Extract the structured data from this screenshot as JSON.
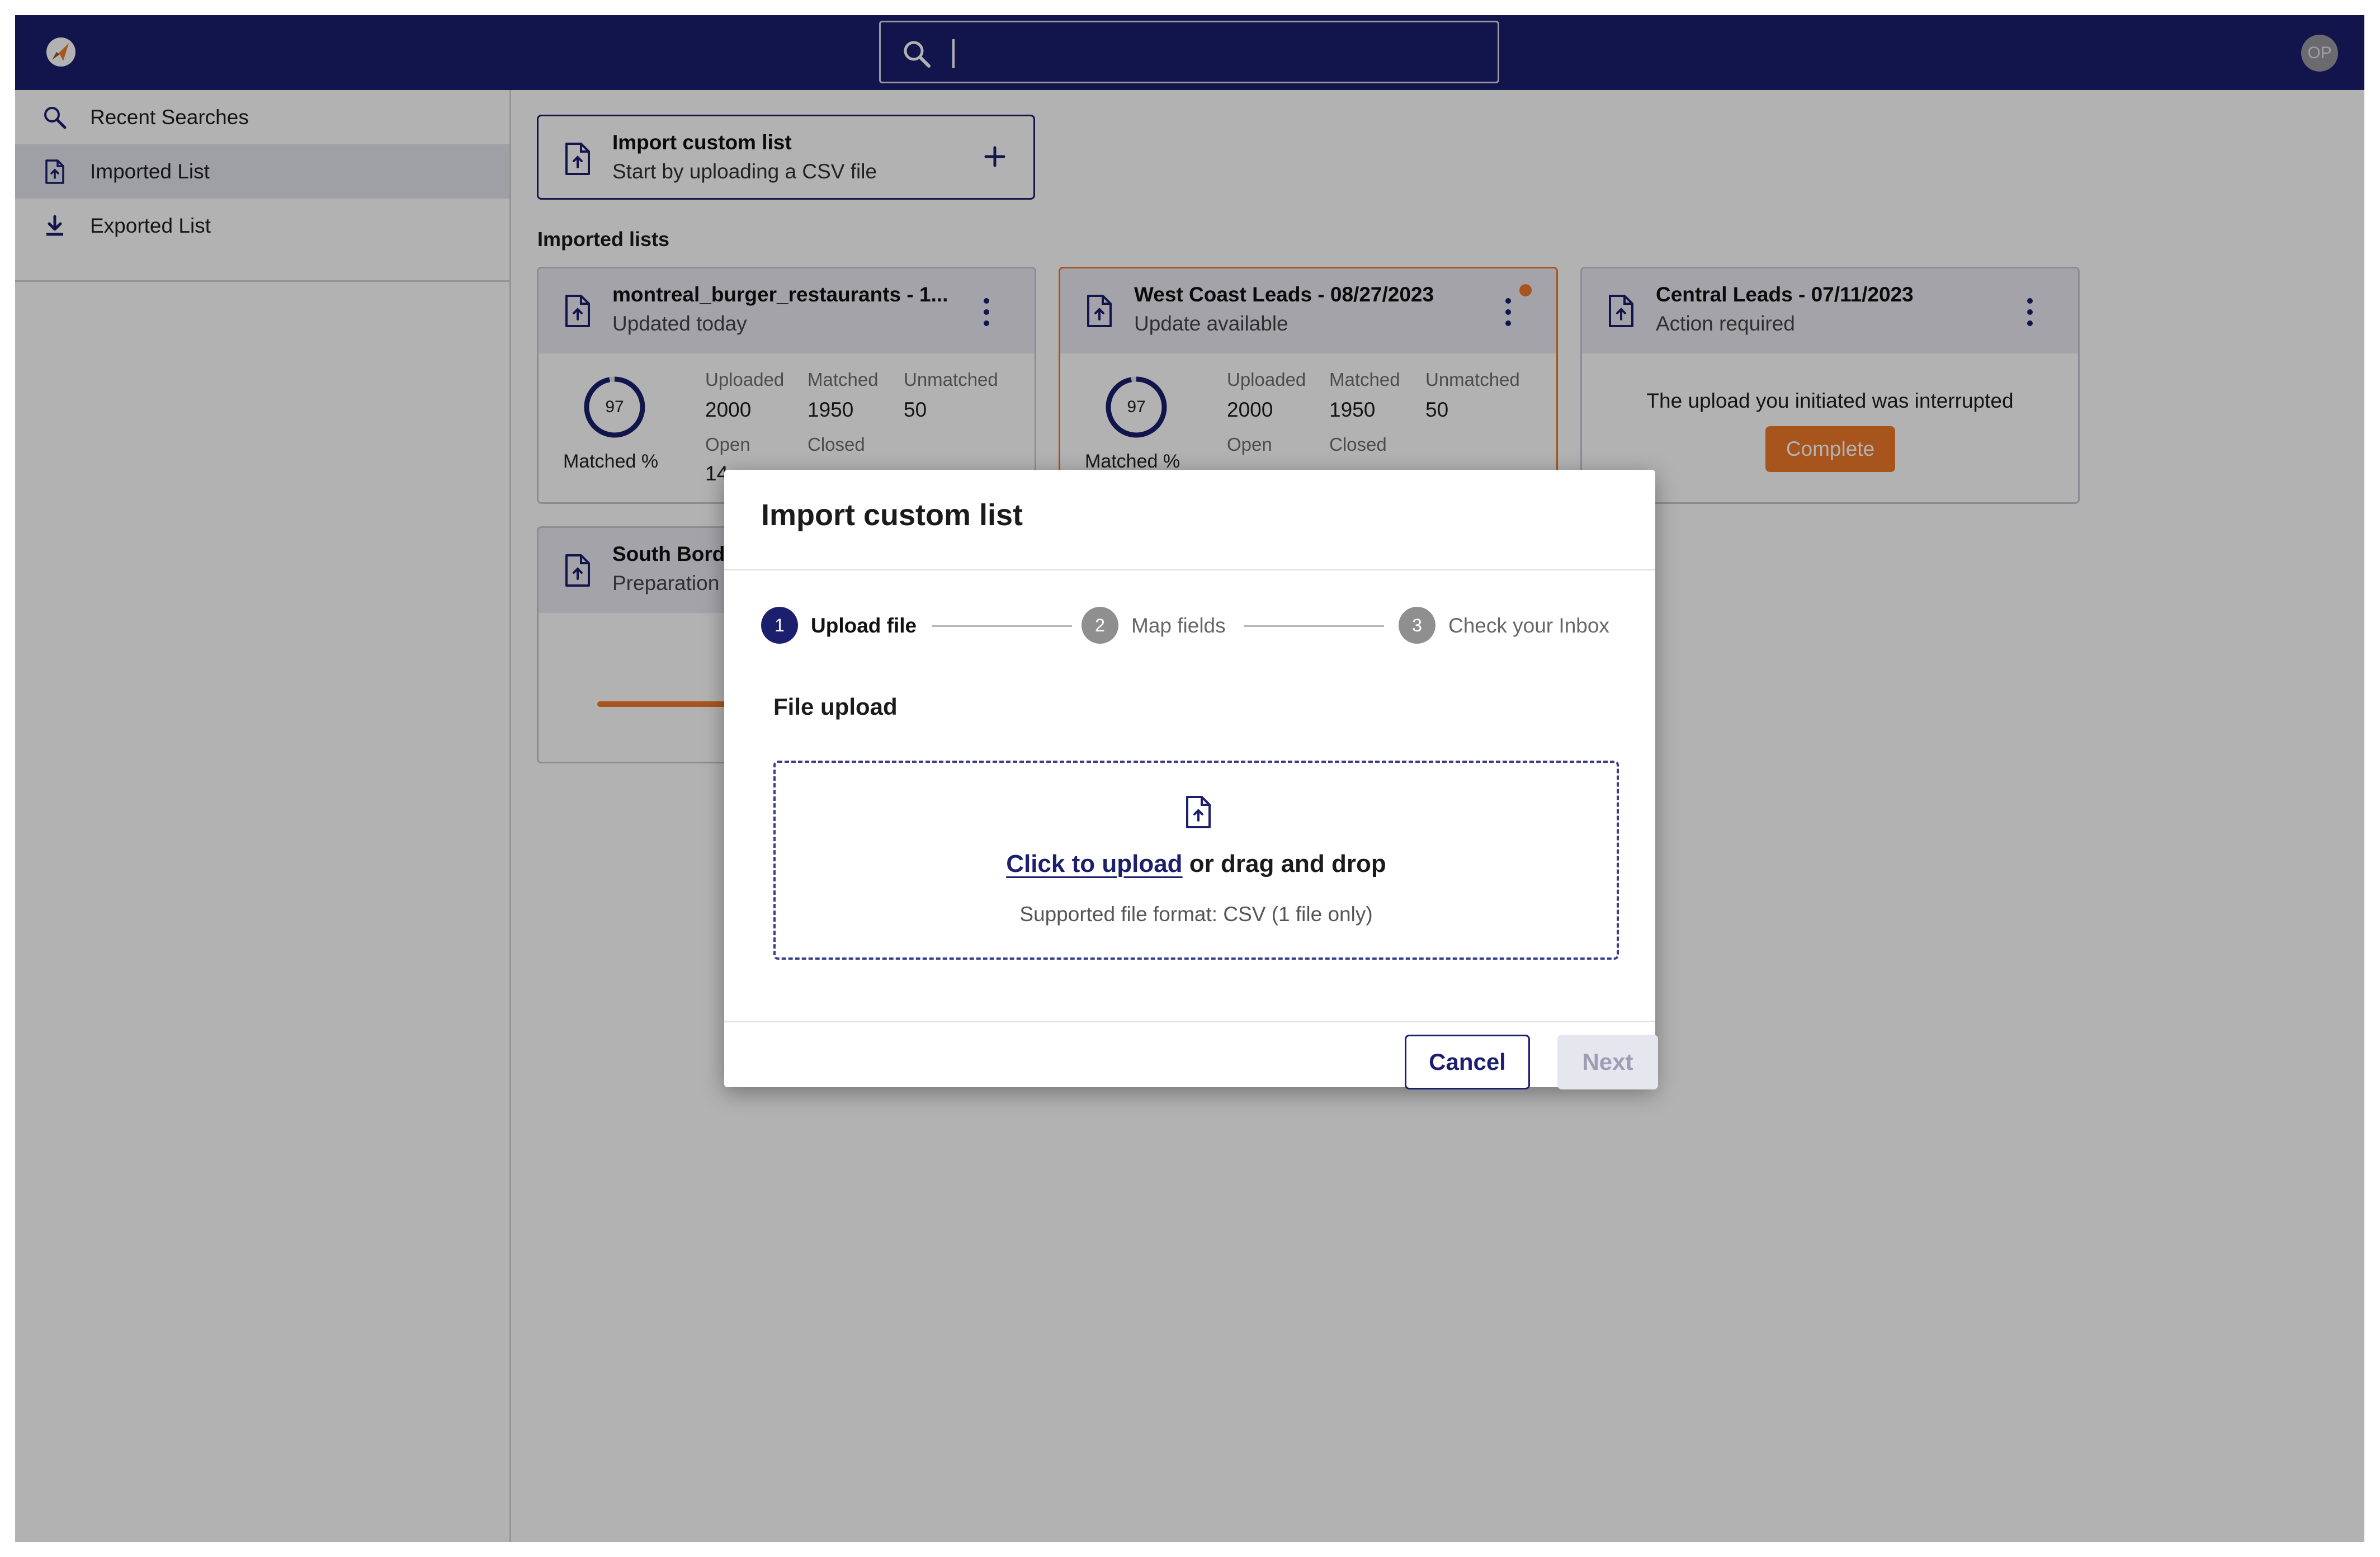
{
  "search": {
    "value": ""
  },
  "user": {
    "initials": "OP"
  },
  "sidebar": {
    "items": [
      {
        "label": "Recent Searches",
        "icon": "search-icon"
      },
      {
        "label": "Imported List",
        "icon": "file-upload-icon"
      },
      {
        "label": "Exported List",
        "icon": "download-icon"
      }
    ]
  },
  "import_button": {
    "title": "Import custom list",
    "subtitle": "Start by uploading a CSV file"
  },
  "section_title": "Imported lists",
  "cards": [
    {
      "title": "montreal_burger_restaurants - 1...",
      "status": "Updated today",
      "matched_pct": "97",
      "matched_pct_fraction": 0.97,
      "matched_label": "Matched %",
      "stats": {
        "uploaded_label": "Uploaded",
        "uploaded": "2000",
        "matched_label": "Matched",
        "matched": "1950",
        "unmatched_label": "Unmatched",
        "unmatched": "50",
        "open_label": "Open",
        "open": "14",
        "closed_label": "Closed"
      }
    },
    {
      "title": "West Coast Leads - 08/27/2023",
      "status": "Update available",
      "matched_pct": "97",
      "matched_pct_fraction": 0.97,
      "matched_label": "Matched %",
      "stats": {
        "uploaded_label": "Uploaded",
        "uploaded": "2000",
        "matched_label": "Matched",
        "matched": "1950",
        "unmatched_label": "Unmatched",
        "unmatched": "50",
        "open_label": "Open",
        "closed_label": "Closed"
      }
    },
    {
      "title": "Central Leads - 07/11/2023",
      "status": "Action required",
      "message": "The upload you initiated was interrupted",
      "action": "Complete"
    },
    {
      "title": "South Bord",
      "status": "Preparation"
    }
  ],
  "modal": {
    "title": "Import custom list",
    "steps": [
      {
        "num": "1",
        "label": "Upload file",
        "active": true
      },
      {
        "num": "2",
        "label": "Map fields",
        "active": false
      },
      {
        "num": "3",
        "label": "Check your Inbox",
        "active": false
      }
    ],
    "section_title": "File upload",
    "dropzone": {
      "link": "Click to upload",
      "text": " or drag and drop",
      "hint": "Supported file format: CSV (1 file only)"
    },
    "cancel": "Cancel",
    "next": "Next"
  },
  "colors": {
    "brand_navy": "#1b1f6e",
    "accent_orange": "#f07a2a"
  }
}
